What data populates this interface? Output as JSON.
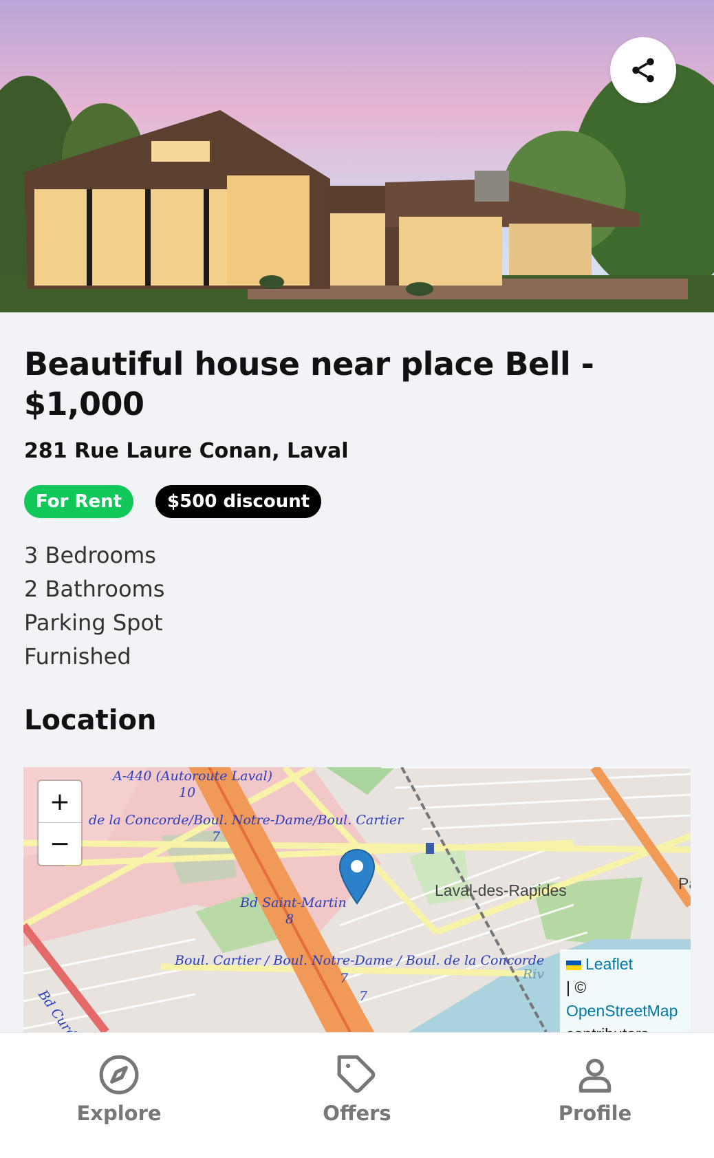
{
  "listing": {
    "title": "Beautiful house near place Bell - $1,000",
    "address": "281 Rue Laure Conan, Laval",
    "badges": {
      "status": "For Rent",
      "discount": "$500 discount"
    },
    "features": [
      "3 Bedrooms",
      "2 Bathrooms",
      "Parking Spot",
      "Furnished"
    ]
  },
  "share": {
    "icon": "share-icon"
  },
  "location": {
    "heading": "Location",
    "map": {
      "zoom_in": "+",
      "zoom_out": "−",
      "labels": {
        "a440": "A-440 (Autoroute Laval)",
        "a440_num": "10",
        "concorde": "de la Concorde/Boul. Notre-Dame/Boul. Cartier",
        "seven_a": "7",
        "saint_martin": "Bd Saint-Martin",
        "eight": "8",
        "cartier": "Boul. Cartier / Boul. Notre-Dame / Boul. de la Concorde",
        "seven_b": "7",
        "seven_c": "7",
        "cure": "Bd Curé-La",
        "riv": "Riv",
        "laval_rapides": "Laval-des-Rapides",
        "pa": "Pa"
      },
      "attribution": {
        "leaflet": "Leaflet",
        "sep": "| ©",
        "osm": "OpenStreetMap",
        "contrib": "contributors"
      }
    }
  },
  "nav": [
    {
      "label": "Explore",
      "icon": "compass-icon"
    },
    {
      "label": "Offers",
      "icon": "tag-icon"
    },
    {
      "label": "Profile",
      "icon": "user-icon"
    }
  ],
  "colors": {
    "rent_badge": "#12c85a",
    "discount_badge": "#000000",
    "link": "#0078a8",
    "marker": "#2b82cb"
  }
}
